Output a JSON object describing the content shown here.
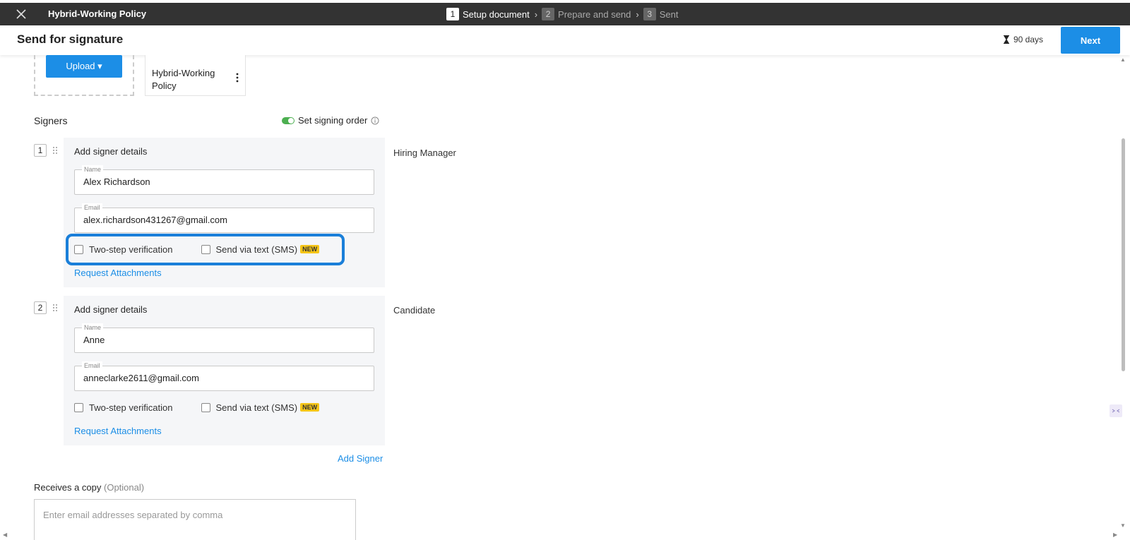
{
  "topbar": {
    "document_title": "Hybrid-Working Policy",
    "steps": [
      {
        "num": "1",
        "label": "Setup document"
      },
      {
        "num": "2",
        "label": "Prepare and send"
      },
      {
        "num": "3",
        "label": "Sent"
      }
    ],
    "step_separator": "›"
  },
  "header": {
    "title": "Send for signature",
    "expiry": "90 days",
    "next_label": "Next"
  },
  "documents": {
    "upload_label": "Upload ▾",
    "files": [
      {
        "name": "Hybrid-Working Policy"
      }
    ]
  },
  "signers": {
    "heading": "Signers",
    "signing_order_label": "Set signing order",
    "list": [
      {
        "order": "1",
        "card_title": "Add signer details",
        "name_label": "Name",
        "name_value": "Alex Richardson",
        "email_label": "Email",
        "email_value": "alex.richardson431267@gmail.com",
        "two_step_label": "Two-step verification",
        "sms_label": "Send via text (SMS)",
        "new_badge": "NEW",
        "request_attachments": "Request Attachments",
        "role": "Hiring Manager"
      },
      {
        "order": "2",
        "card_title": "Add signer details",
        "name_label": "Name",
        "name_value": "Anne",
        "email_label": "Email",
        "email_value": "anneclarke2611@gmail.com",
        "two_step_label": "Two-step verification",
        "sms_label": "Send via text (SMS)",
        "new_badge": "NEW",
        "request_attachments": "Request Attachments",
        "role": "Candidate"
      }
    ],
    "add_signer": "Add Signer"
  },
  "copy": {
    "heading": "Receives a copy",
    "optional": "(Optional)",
    "placeholder": "Enter email addresses separated by comma"
  },
  "colors": {
    "topbar": "#333333",
    "accent": "#1c8ee6",
    "highlight": "#1a7fd9",
    "toggle_on": "#4caf50",
    "new_badge": "#f5c518"
  },
  "icons": [
    "close-icon",
    "hourglass-icon",
    "kebab-menu-icon",
    "info-icon",
    "drag-handle-icon",
    "chevron-right-icon"
  ]
}
